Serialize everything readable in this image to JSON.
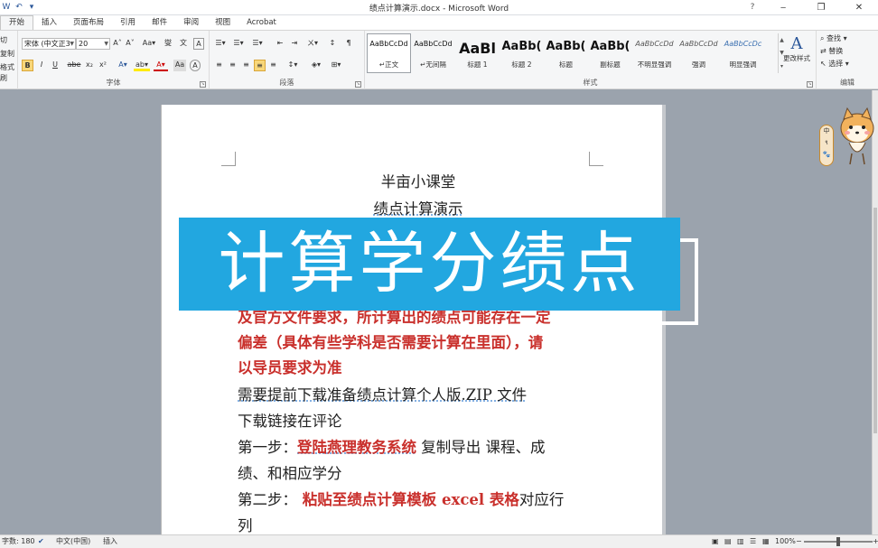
{
  "window": {
    "title": "绩点计算演示.docx - Microsoft Word",
    "controls": {
      "minimize": "‒",
      "maximize": "❐",
      "close": "✕"
    },
    "help": "?"
  },
  "quick_access": [
    "W",
    "↶",
    "▾"
  ],
  "tabs": [
    {
      "label": "开始"
    },
    {
      "label": "插入"
    },
    {
      "label": "页面布局"
    },
    {
      "label": "引用"
    },
    {
      "label": "邮件"
    },
    {
      "label": "审阅"
    },
    {
      "label": "视图"
    },
    {
      "label": "Acrobat"
    }
  ],
  "ribbon": {
    "clipboard_partial": [
      "切",
      "复制",
      "格式刷"
    ],
    "font": {
      "name": "宋体 (中文正3",
      "size": "20",
      "row1": [
        "A˄",
        "A˅",
        "Aa▾",
        "燮",
        "文",
        "A"
      ],
      "row2": [
        "B",
        "I",
        "U",
        "abe",
        "x₂",
        "x²",
        "A▾",
        "ab▾",
        "A▾",
        "Aa",
        "A"
      ],
      "label": "字体"
    },
    "paragraph": {
      "row1": [
        "☰▾",
        "☰▾",
        "☰▾",
        "⇤",
        "⇥",
        "ㄨ▾",
        "↕",
        "¶"
      ],
      "row2": [
        "≡",
        "≡",
        "≡",
        "≡",
        "≡",
        "↕▾",
        "◈▾",
        "⊞▾"
      ],
      "label": "段落"
    },
    "styles": {
      "items": [
        {
          "preview": "AaBbCcDd",
          "name": "↵正文",
          "size": "8px",
          "bold": false,
          "selected": true
        },
        {
          "preview": "AaBbCcDd",
          "name": "↵无间隔",
          "size": "8px",
          "bold": false,
          "selected": false
        },
        {
          "preview": "AaBl",
          "name": "标题 1",
          "size": "16px",
          "bold": true,
          "selected": false
        },
        {
          "preview": "AaBb(",
          "name": "标题 2",
          "size": "13px",
          "bold": true,
          "selected": false
        },
        {
          "preview": "AaBb(",
          "name": "标题",
          "size": "13px",
          "bold": true,
          "selected": false
        },
        {
          "preview": "AaBb(",
          "name": "副标题",
          "size": "13px",
          "bold": true,
          "selected": false
        },
        {
          "preview": "AaBbCcDd",
          "name": "不明显强调",
          "size": "8px",
          "bold": false,
          "selected": false
        },
        {
          "preview": "AaBbCcDd",
          "name": "强调",
          "size": "8px",
          "bold": false,
          "selected": false
        },
        {
          "preview": "AaBbCcDc",
          "name": "明显强调",
          "size": "8px",
          "bold": false,
          "selected": false
        }
      ],
      "change_label": "更改样式",
      "label": "样式"
    },
    "editing": {
      "find": "查找 ▾",
      "replace": "替换",
      "select": "选择 ▾",
      "label": "编辑"
    }
  },
  "document": {
    "title_line1": "半亩小课堂",
    "title_line2": "绩点计算演示",
    "partial_line": "及官方文件要求，所计算出的绩点可能存在一定",
    "red_line2": "偏差（具体有些学科是否需要计算在里面），请",
    "red_line3": "以导员要求为准",
    "line_download_1": "需要提前下载准备绩点计算个人版.ZIP 文件",
    "line_download_2": "下载链接在评论",
    "step1_label": "第一步：",
    "step1_red": "登陆燕理教务系统",
    "step1_rest": " 复制导出 课程、成",
    "step1_cont": "绩、和相应学分",
    "step2_label": "第二步：",
    "step2_red": " 粘贴至绩点计算模板 excel 表格",
    "step2_rest": "对应行",
    "step2_cont": "列"
  },
  "banner": {
    "text": "计算学分绩点"
  },
  "ime": {
    "lines": [
      "中",
      "९",
      "🐾"
    ]
  },
  "status": {
    "word_count": "字数: 180",
    "language": "中文(中国)",
    "mode": "插入",
    "zoom": "100%",
    "zoom_level": 0.5
  },
  "colors": {
    "accent": "#2b579a",
    "banner": "#22a7e0",
    "red_text": "#c9302c"
  }
}
